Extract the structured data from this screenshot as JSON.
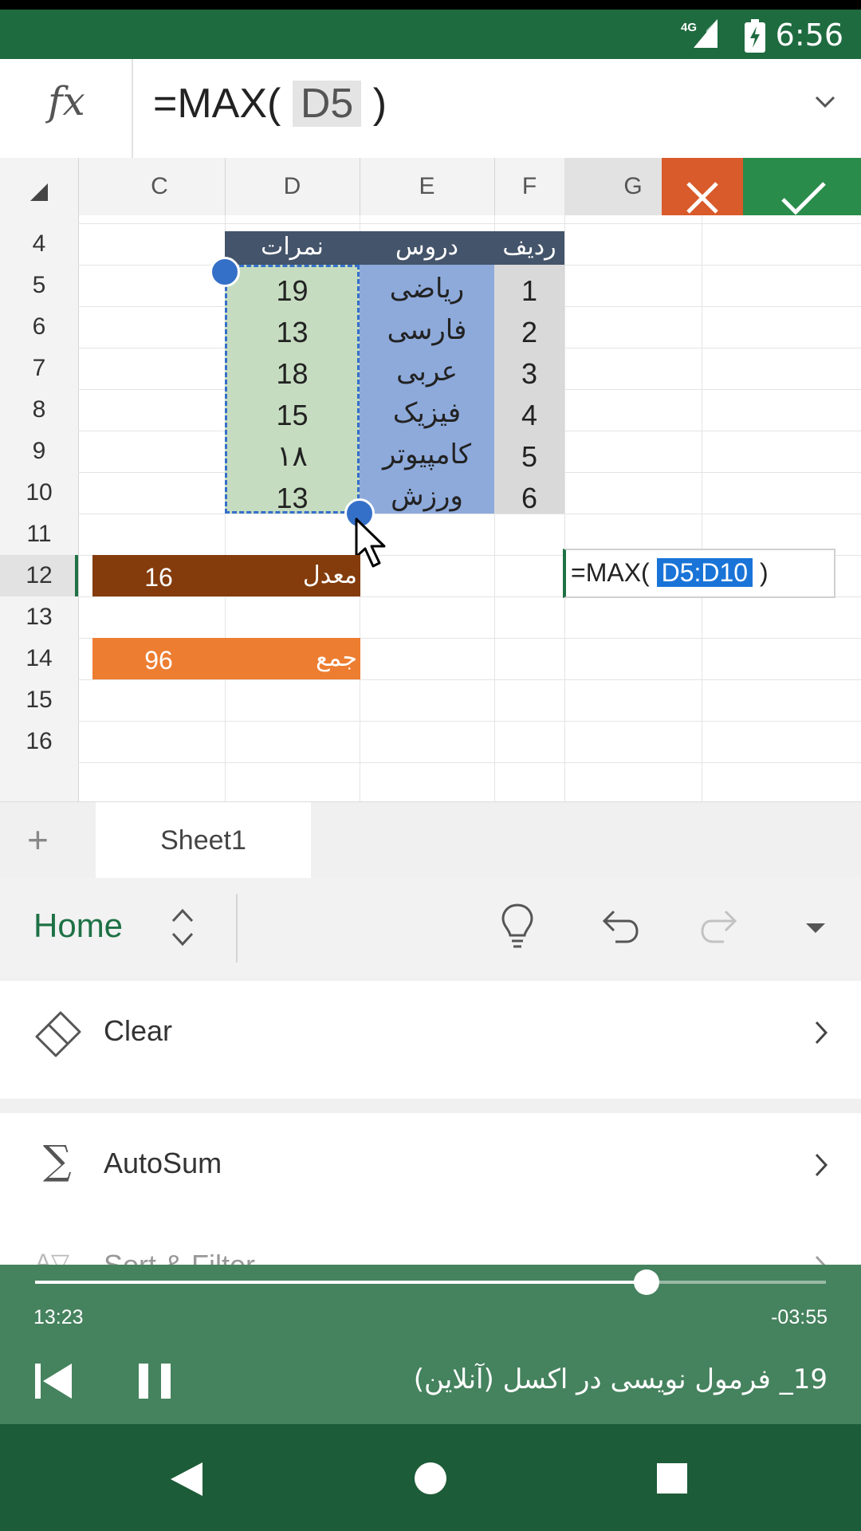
{
  "status_bar": {
    "time": "6:56",
    "network": "4G"
  },
  "formula_bar": {
    "fx_label": "fx",
    "formula_prefix": "=MAX(",
    "formula_ref": "D5",
    "formula_suffix": ")"
  },
  "columns": [
    "C",
    "D",
    "E",
    "F",
    "G"
  ],
  "rows": [
    "4",
    "5",
    "6",
    "7",
    "8",
    "9",
    "10",
    "11",
    "12",
    "13",
    "14",
    "15",
    "16"
  ],
  "table": {
    "headers": {
      "grades": "نمرات",
      "subjects": "دروس",
      "index": "ردیف"
    },
    "grades": [
      "19",
      "13",
      "18",
      "15",
      "۱۸",
      "13"
    ],
    "subjects": [
      "ریاضی",
      "فارسی",
      "عربی",
      "فیزیک",
      "کامپیوتر",
      "ورزش"
    ],
    "index": [
      "1",
      "2",
      "3",
      "4",
      "5",
      "6"
    ]
  },
  "summary": {
    "average_label": "معدل",
    "average_value": "16",
    "sum_label": "جمع",
    "sum_value": "96"
  },
  "edit_cell": {
    "prefix": "=MAX(",
    "range": "D5:D10",
    "suffix": ")"
  },
  "sheet_tab": "Sheet1",
  "ribbon": {
    "tab_label": "Home"
  },
  "commands": [
    {
      "label": "Clear",
      "icon": "eraser-icon"
    },
    {
      "label": "AutoSum",
      "icon": "sigma-icon"
    },
    {
      "label": "Sort & Filter",
      "icon": "sort-filter-icon"
    }
  ],
  "video": {
    "elapsed": "13:23",
    "remaining": "-03:55",
    "progress": 0.7727,
    "title": "19_ فرمول نویسی در اکسل (آنلاین)"
  },
  "colors": {
    "status_green": "#1e6b3f",
    "table_header": "#44546a",
    "grade_fill": "#c6dcc0",
    "subject_fill": "#8eaadb",
    "index_fill": "#d9d9d9",
    "average_fill": "#843c0c",
    "sum_fill": "#ed7d31",
    "cancel_red": "#d95a2b",
    "confirm_green": "#2a8c4a"
  }
}
